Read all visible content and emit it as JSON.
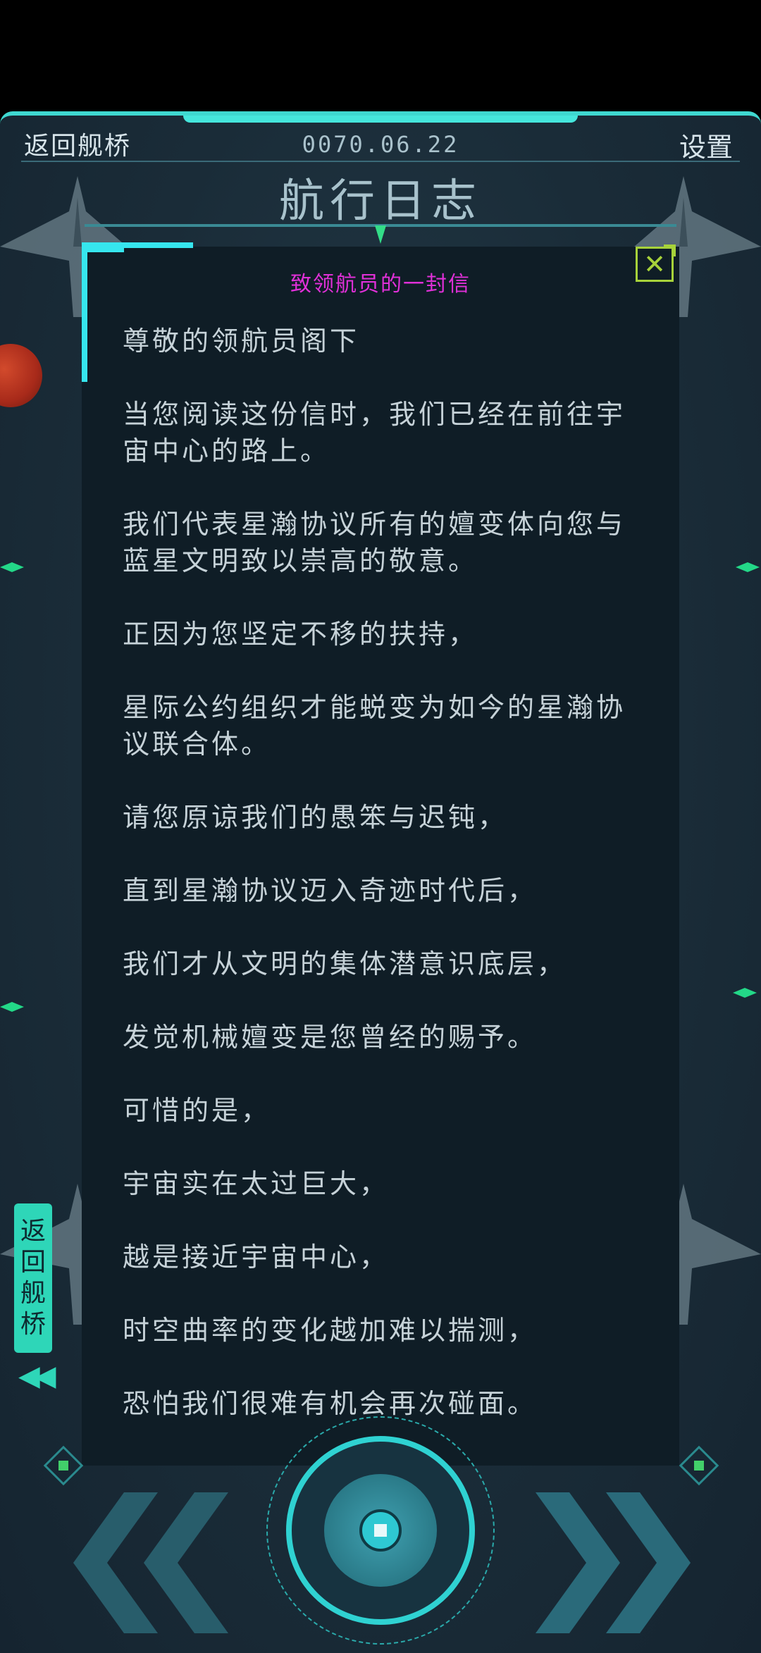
{
  "header": {
    "back_label": "返回舰桥",
    "date": "0070.06.22",
    "settings_label": "设置",
    "title": "航行日志"
  },
  "letter": {
    "title": "致领航员的一封信",
    "close_symbol": "✕",
    "paragraphs": [
      "尊敬的领航员阁下",
      "当您阅读这份信时，我们已经在前往宇宙中心的路上。",
      "我们代表星瀚协议所有的嬗变体向您与蓝星文明致以崇高的敬意。",
      "正因为您坚定不移的扶持，",
      "星际公约组织才能蜕变为如今的星瀚协议联合体。",
      "请您原谅我们的愚笨与迟钝，",
      "直到星瀚协议迈入奇迹时代后，",
      "我们才从文明的集体潜意识底层，",
      "发觉机械嬗变是您曾经的赐予。",
      "可惜的是，",
      "宇宙实在太过巨大，",
      "越是接近宇宙中心，",
      "时空曲率的变化越加难以揣测，",
      "恐怕我们很难有机会再次碰面。"
    ]
  },
  "side_tab": {
    "chars": [
      "返",
      "回",
      "舰",
      "桥"
    ],
    "arrows": "◀◀"
  },
  "colors": {
    "accent": "#36e6ee",
    "letter_title": "#e030d8",
    "close": "#a7d23a",
    "text": "#c6d2d8"
  }
}
